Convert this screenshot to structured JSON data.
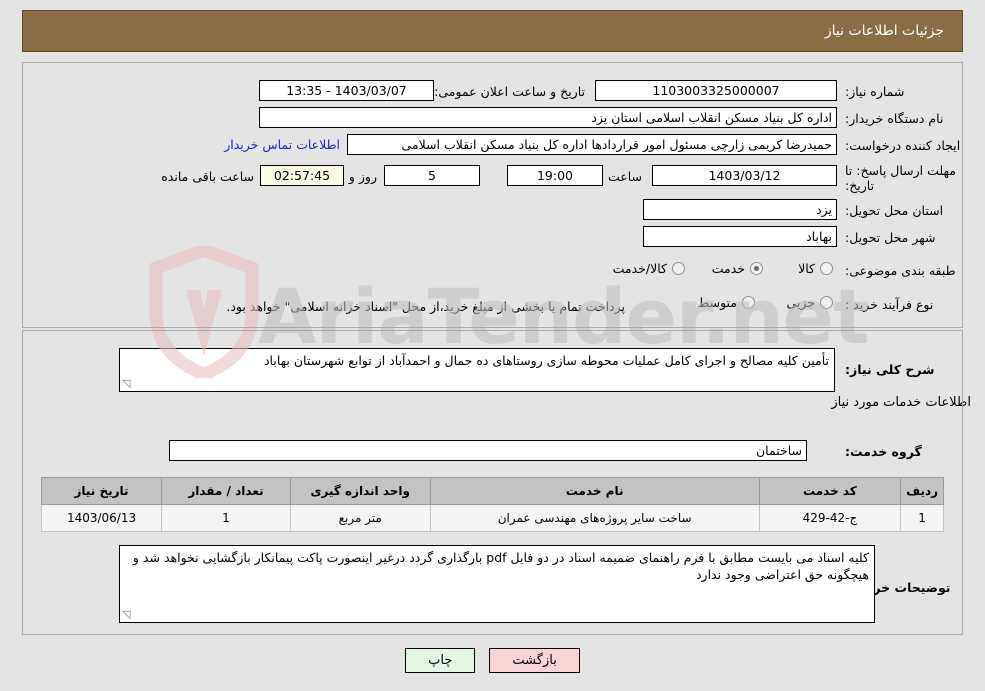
{
  "header": {
    "title": "جزئیات اطلاعات نیاز"
  },
  "watermark": {
    "text": "AriaTender.net"
  },
  "form": {
    "need_number_label": "شماره نیاز:",
    "need_number_value": "1103003325000007",
    "public_announce_label": "تاریخ و ساعت اعلان عمومی:",
    "public_announce_value": "1403/03/07 - 13:35",
    "buyer_org_label": "نام دستگاه خریدار:",
    "buyer_org_value": "اداره کل بنیاد مسکن انقلاب اسلامی استان یزد",
    "requester_label": "ایجاد کننده درخواست:",
    "requester_value": "حمیدرضا کریمی زارچی مسئول امور قراردادها اداره کل بنیاد مسکن انقلاب اسلامی",
    "contact_link": "اطلاعات تماس خریدار",
    "deadline_label": "مهلت ارسال پاسخ: تا تاریخ:",
    "deadline_date": "1403/03/12",
    "hour_label": "ساعت",
    "hour_value": "19:00",
    "days_value": "5",
    "days_label": "روز و",
    "timer_value": "02:57:45",
    "timer_label": "ساعت باقی مانده",
    "province_label": "استان محل تحویل:",
    "province_value": "یزد",
    "city_label": "شهر محل تحویل:",
    "city_value": "بهاباد",
    "category_label": "طبقه بندی موضوعی:",
    "category_options": [
      "کالا",
      "خدمت",
      "کالا/خدمت"
    ],
    "category_selected": "خدمت",
    "process_label": "نوع فرآیند خرید :",
    "process_options": [
      "جزیی",
      "متوسط"
    ],
    "process_selected": "",
    "treasury_note": "پرداخت تمام یا بخشی از مبلغ خرید،از محل \"اسناد خزانه اسلامی\" خواهد بود.",
    "general_desc_label": "شرح کلی نیاز:",
    "general_desc_value": "تأمین کلیه مصالح و اجرای کامل عملیات محوطه سازی روستاهای ده جمال و احمدآباد از توابع شهرستان بهاباد",
    "services_section_title": "اطلاعات خدمات مورد نیاز",
    "service_group_label": "گروه خدمت:",
    "service_group_value": "ساختمان",
    "buyer_notes_label": "توضیحات خریدار:",
    "buyer_notes_value": "کلیه اسناد می بایست مطابق با فرم راهنمای ضمیمه اسناد در دو فایل pdf بارگذاری گردد درغیر اینصورت  پاکت پیمانکار بازگشایی نخواهد شد و هیچگونه حق اعتراضی وجود ندارد"
  },
  "table": {
    "columns": [
      "ردیف",
      "کد خدمت",
      "نام خدمت",
      "واحد اندازه گیری",
      "تعداد / مقدار",
      "تاریخ نیاز"
    ],
    "rows": [
      {
        "row_no": "1",
        "service_code": "ج-42-429",
        "service_name": "ساخت سایر پروژه‌های مهندسی عمران",
        "unit": "متر مربع",
        "quantity": "1",
        "need_date": "1403/06/13"
      }
    ]
  },
  "footer": {
    "print_label": "چاپ",
    "back_label": "بازگشت"
  },
  "colors": {
    "header_bg": "#8a6d45",
    "link": "#2020cc",
    "table_header_bg": "#c3c3c3",
    "timer_bg": "#fcfbe8",
    "print_btn_bg": "#e6f6e4",
    "back_btn_bg": "#f9d4d4"
  }
}
